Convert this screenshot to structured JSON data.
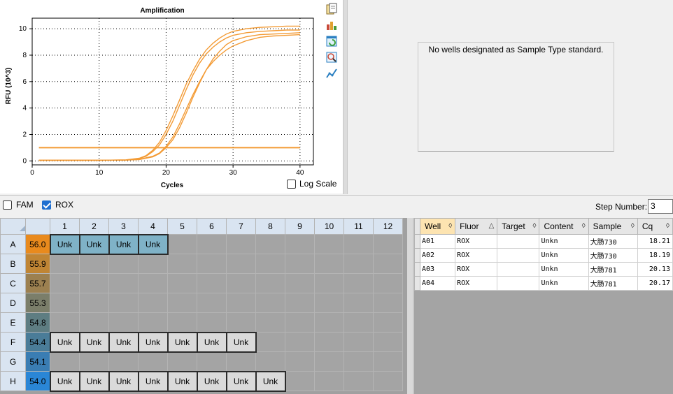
{
  "chart_data": {
    "type": "line",
    "title": "Amplification",
    "xlabel": "Cycles",
    "ylabel": "RFU (10^3)",
    "xlim": [
      0,
      42
    ],
    "ylim": [
      -0.3,
      10.8
    ],
    "xticks": [
      0,
      10,
      20,
      30,
      40
    ],
    "yticks": [
      0,
      2,
      4,
      6,
      8,
      10
    ],
    "grid": true,
    "series": [
      {
        "color": "#f39b35",
        "x": [
          1,
          5,
          10,
          14,
          16,
          17,
          18,
          19,
          20,
          21,
          22,
          23,
          24,
          25,
          26,
          27,
          28,
          29,
          30,
          32,
          34,
          36,
          38,
          40
        ],
        "y": [
          0.05,
          0.05,
          0.05,
          0.08,
          0.2,
          0.4,
          0.8,
          1.4,
          2.3,
          3.4,
          4.6,
          5.8,
          6.8,
          7.7,
          8.4,
          8.9,
          9.3,
          9.6,
          9.8,
          10.0,
          10.1,
          10.15,
          10.2,
          10.2
        ]
      },
      {
        "color": "#f39b35",
        "x": [
          1,
          5,
          10,
          14,
          16,
          17,
          18,
          19,
          20,
          21,
          22,
          23,
          24,
          25,
          26,
          27,
          28,
          29,
          30,
          32,
          34,
          36,
          38,
          40
        ],
        "y": [
          0.05,
          0.05,
          0.05,
          0.07,
          0.18,
          0.35,
          0.7,
          1.2,
          2.0,
          3.0,
          4.2,
          5.4,
          6.5,
          7.4,
          8.1,
          8.6,
          9.0,
          9.3,
          9.5,
          9.7,
          9.8,
          9.85,
          9.9,
          9.9
        ]
      },
      {
        "color": "#f39b35",
        "x": [
          1,
          5,
          10,
          14,
          16,
          18,
          19,
          20,
          21,
          22,
          23,
          24,
          25,
          26,
          27,
          28,
          29,
          30,
          32,
          34,
          36,
          38,
          40
        ],
        "y": [
          0.05,
          0.05,
          0.05,
          0.06,
          0.1,
          0.3,
          0.55,
          1.0,
          1.6,
          2.5,
          3.6,
          4.8,
          5.9,
          6.9,
          7.7,
          8.3,
          8.8,
          9.1,
          9.4,
          9.55,
          9.6,
          9.65,
          9.7
        ]
      },
      {
        "color": "#f39b35",
        "x": [
          1,
          5,
          10,
          14,
          16,
          18,
          19,
          20,
          21,
          22,
          23,
          24,
          25,
          26,
          27,
          28,
          29,
          30,
          32,
          34,
          36,
          38,
          40
        ],
        "y": [
          0.05,
          0.05,
          0.05,
          0.06,
          0.12,
          0.35,
          0.6,
          1.1,
          1.8,
          2.8,
          3.9,
          5.0,
          6.0,
          6.9,
          7.5,
          8.0,
          8.4,
          8.7,
          9.1,
          9.35,
          9.45,
          9.5,
          9.55
        ]
      },
      {
        "color": "#f39b35",
        "x": [
          1,
          40
        ],
        "y": [
          1.0,
          1.0
        ],
        "width": 2
      }
    ]
  },
  "chart_toolbar": {
    "icons": [
      "copy-icon",
      "export-icon",
      "refresh-icon",
      "zoom-icon",
      "series-icon"
    ]
  },
  "log_scale_label": "Log Scale",
  "standard_panel": {
    "message": "No wells designated as Sample Type standard."
  },
  "fluors": [
    {
      "label": "FAM",
      "checked": false
    },
    {
      "label": "ROX",
      "checked": true
    }
  ],
  "step": {
    "label": "Step Number:",
    "value": "3"
  },
  "plate": {
    "columns": [
      "1",
      "2",
      "3",
      "4",
      "5",
      "6",
      "7",
      "8",
      "9",
      "10",
      "11",
      "12"
    ],
    "rows": [
      {
        "letter": "A",
        "temp": "56.0",
        "temp_color": "#e98a1d",
        "wells": [
          "Unk",
          "Unk",
          "Unk",
          "Unk",
          "",
          "",
          "",
          "",
          "",
          "",
          "",
          ""
        ],
        "selected": [
          0,
          1,
          2,
          3
        ]
      },
      {
        "letter": "B",
        "temp": "55.9",
        "temp_color": "#c08534",
        "wells": [
          "",
          "",
          "",
          "",
          "",
          "",
          "",
          "",
          "",
          "",
          "",
          ""
        ]
      },
      {
        "letter": "C",
        "temp": "55.7",
        "temp_color": "#9c8050",
        "wells": [
          "",
          "",
          "",
          "",
          "",
          "",
          "",
          "",
          "",
          "",
          "",
          ""
        ]
      },
      {
        "letter": "D",
        "temp": "55.3",
        "temp_color": "#7b7e6a",
        "wells": [
          "",
          "",
          "",
          "",
          "",
          "",
          "",
          "",
          "",
          "",
          "",
          ""
        ]
      },
      {
        "letter": "E",
        "temp": "54.8",
        "temp_color": "#5e7d82",
        "wells": [
          "",
          "",
          "",
          "",
          "",
          "",
          "",
          "",
          "",
          "",
          "",
          ""
        ]
      },
      {
        "letter": "F",
        "temp": "54.4",
        "temp_color": "#4a7c98",
        "wells": [
          "Unk",
          "Unk",
          "Unk",
          "Unk",
          "Unk",
          "Unk",
          "Unk",
          "",
          "",
          "",
          "",
          ""
        ]
      },
      {
        "letter": "G",
        "temp": "54.1",
        "temp_color": "#3a7db3",
        "wells": [
          "",
          "",
          "",
          "",
          "",
          "",
          "",
          "",
          "",
          "",
          "",
          ""
        ]
      },
      {
        "letter": "H",
        "temp": "54.0",
        "temp_color": "#2a86d6",
        "wells": [
          "Unk",
          "Unk",
          "Unk",
          "Unk",
          "Unk",
          "Unk",
          "Unk",
          "Unk",
          "",
          "",
          "",
          ""
        ]
      }
    ]
  },
  "results": {
    "columns": [
      {
        "label": "Well",
        "sort": "◊",
        "sorted": true
      },
      {
        "label": "Fluor",
        "sort": "△",
        "sorted": false
      },
      {
        "label": "Target",
        "sort": "◊",
        "sorted": false
      },
      {
        "label": "Content",
        "sort": "◊",
        "sorted": false
      },
      {
        "label": "Sample",
        "sort": "◊",
        "sorted": false
      },
      {
        "label": "Cq",
        "sort": "◊",
        "sorted": false
      }
    ],
    "rows": [
      [
        "A01",
        "ROX",
        "",
        "Unkn",
        "大肠730",
        "18.21"
      ],
      [
        "A02",
        "ROX",
        "",
        "Unkn",
        "大肠730",
        "18.19"
      ],
      [
        "A03",
        "ROX",
        "",
        "Unkn",
        "大肠781",
        "20.13"
      ],
      [
        "A04",
        "ROX",
        "",
        "Unkn",
        "大肠781",
        "20.17"
      ]
    ]
  }
}
